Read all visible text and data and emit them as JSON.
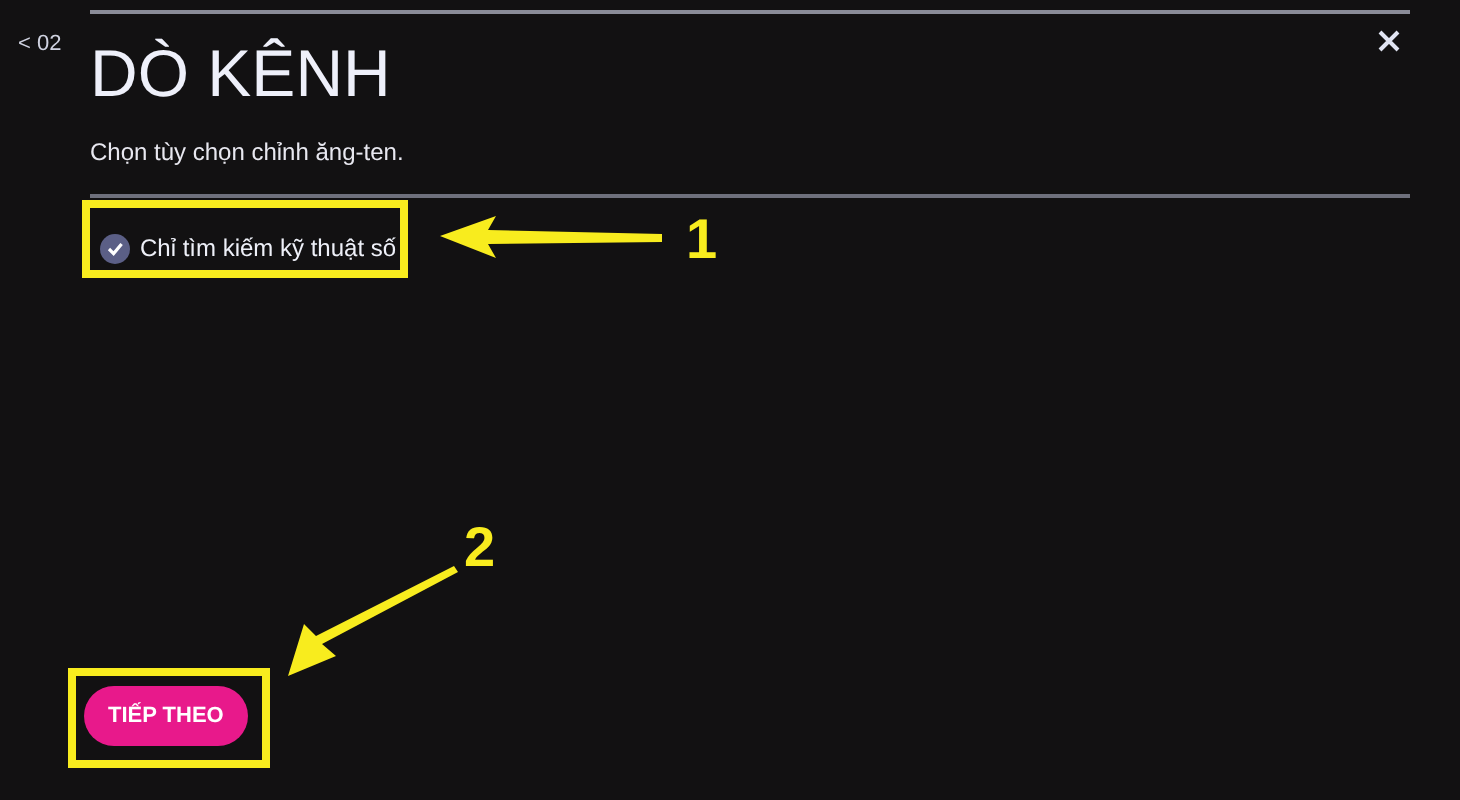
{
  "back": {
    "label": "< 02"
  },
  "title": "DÒ KÊNH",
  "subtitle": "Chọn tùy chọn chỉnh ăng-ten.",
  "options": [
    {
      "label": "Chỉ tìm kiếm kỹ thuật số",
      "checked": true
    }
  ],
  "next_button": {
    "label": "TIẾP THEO"
  },
  "annotations": [
    {
      "label": "1"
    },
    {
      "label": "2"
    }
  ]
}
